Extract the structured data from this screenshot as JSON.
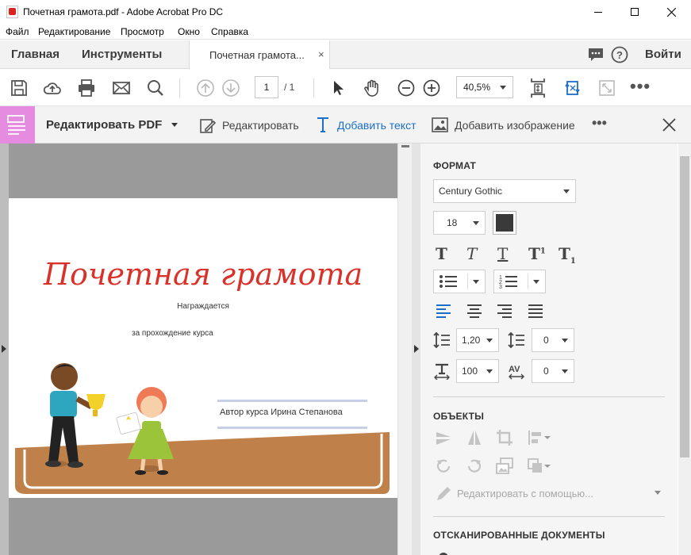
{
  "window": {
    "title": "Почетная грамота.pdf - Adobe Acrobat Pro DC",
    "controls": [
      "minimize-icon",
      "maximize-icon",
      "close-icon"
    ]
  },
  "menu": [
    "Файл",
    "Редактирование",
    "Просмотр",
    "Окно",
    "Справка"
  ],
  "nav": {
    "home": "Главная",
    "tools": "Инструменты",
    "doc_tab": "Почетная грамота...",
    "doc_tab_close": "×",
    "sign_in": "Войти"
  },
  "toolbar": {
    "page_current": "1",
    "page_total": "/ 1",
    "zoom": "40,5%"
  },
  "edit_toolbar": {
    "title": "Редактировать PDF",
    "edit": "Редактировать",
    "add_text": "Добавить текст",
    "add_image": "Добавить изображение",
    "more": "•••"
  },
  "document": {
    "title": "Почетная грамота",
    "line1": "Награждается",
    "line2": "за прохождение курса",
    "author": "Автор курса Ирина Степанова",
    "accent_color": "#d9322b"
  },
  "format": {
    "heading": "ФОРМАТ",
    "font": "Century Gothic",
    "size": "18",
    "color": "#3a3a3a",
    "line_spacing": "1,20",
    "para_spacing": "0",
    "scale": "100",
    "char_spacing": "0"
  },
  "objects": {
    "heading": "ОБЪЕКТЫ",
    "edit_using": "Редактировать с помощью..."
  },
  "scanned": {
    "heading": "ОТСКАНИРОВАННЫЕ ДОКУМЕНТЫ"
  }
}
